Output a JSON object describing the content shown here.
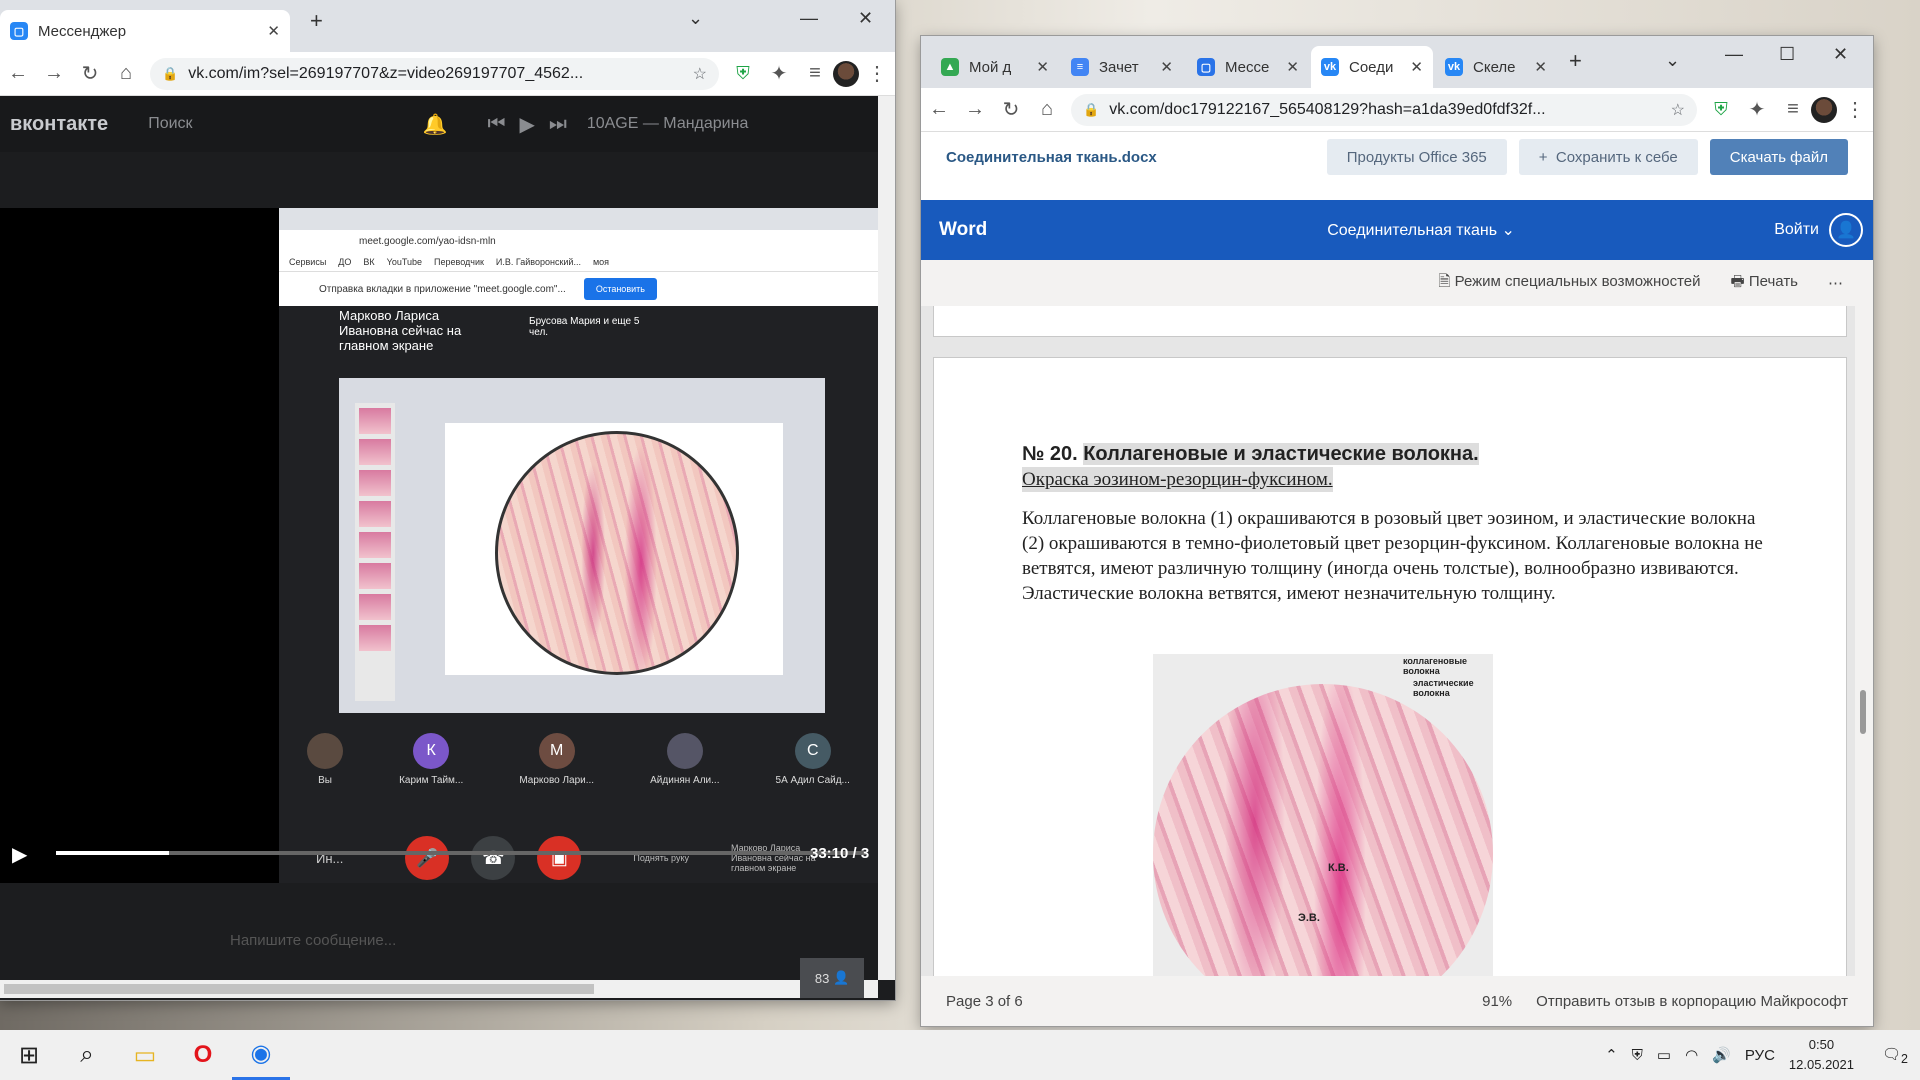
{
  "left_window": {
    "tab_title": "Мессенджер",
    "url": "vk.com/im?sel=269197707&z=video269197707_4562...",
    "vk_logo": "вконтакте",
    "search_placeholder": "Поиск",
    "track": "10AGE — Мандарина",
    "inner_browser": {
      "url": "meet.google.com/yao-idsn-mln",
      "bookmarks": [
        "Сервисы",
        "ДО",
        "ВК",
        "YouTube",
        "Переводчик",
        "И.В. Гайворонский...",
        "моя"
      ],
      "share_text": "Отправка вкладки в приложение \"meet.google.com\"...",
      "share_button": "Остановить",
      "presenter_text": "Марково Лариса Ивановна сейчас на главном экране",
      "participants_summary": "Брусова Мария и еще 5 чел.",
      "participants": [
        {
          "name": "Вы",
          "initial": "",
          "color": "#5a4a40"
        },
        {
          "name": "Карим Тайм...",
          "initial": "К",
          "color": "#7b57c9"
        },
        {
          "name": "Марково Лари...",
          "initial": "М",
          "color": "#6d4c41"
        },
        {
          "name": "Айдинян Али...",
          "initial": "",
          "color": "#556"
        },
        {
          "name": "5А Адил Сайд...",
          "initial": "С",
          "color": "#455a64"
        }
      ],
      "bottom_left": "Ин...",
      "bottom_right": "Марково Лариса Ивановна сейчас на главном экране",
      "raise_hand": "Поднять руку"
    },
    "video_time": "33:10 / 3",
    "video_progress": 0.14,
    "message_placeholder": "Напишите сообщение...",
    "viewers": "83"
  },
  "right_window": {
    "tabs": [
      {
        "label": "Мой д",
        "color": "#34a853"
      },
      {
        "label": "Зачет",
        "color": "#4285f4"
      },
      {
        "label": "Мессе",
        "color": "#2a73e8"
      },
      {
        "label": "Соеди",
        "color": "#2787f5"
      },
      {
        "label": "Скеле",
        "color": "#2787f5"
      }
    ],
    "url": "vk.com/doc179122167_565408129?hash=a1da39ed0fdf32f...",
    "doc_name": "Соединительная ткань.docx",
    "office_button": "Продукты Office 365",
    "save_button": "Сохранить к себе",
    "download_button": "Скачать файл",
    "word_label": "Word",
    "word_doc_title": "Соединительная ткань",
    "login": "Войти",
    "accessibility": "Режим специальных возможностей",
    "print": "Печать",
    "heading_num": "№ 20.",
    "heading": "Коллагеновые и эластические волокна.",
    "subheading": "Окраска эозином-резорцин-фуксином.",
    "paragraph": "Коллагеновые волокна (1) окрашиваются в розовый цвет эозином, и эластические волокна (2) окрашиваются в темно-фиолетовый  цвет  резорцин-фуксином. Коллагеновые волокна не ветвятся, имеют различную толщину (иногда очень толстые), волнообразно извиваются. Эластические волокна ветвятся, имеют незначительную толщину.",
    "labels": {
      "collagen": "коллагеновые волокна",
      "elastic": "эластические волокна",
      "kv": "К.В.",
      "ev": "Э.В."
    },
    "page_status": "Page 3 of 6",
    "zoom": "91%",
    "feedback": "Отправить отзыв в корпорацию Майкрософт"
  },
  "taskbar": {
    "lang": "РУС",
    "time": "0:50",
    "date": "12.05.2021",
    "notifications": "2"
  }
}
